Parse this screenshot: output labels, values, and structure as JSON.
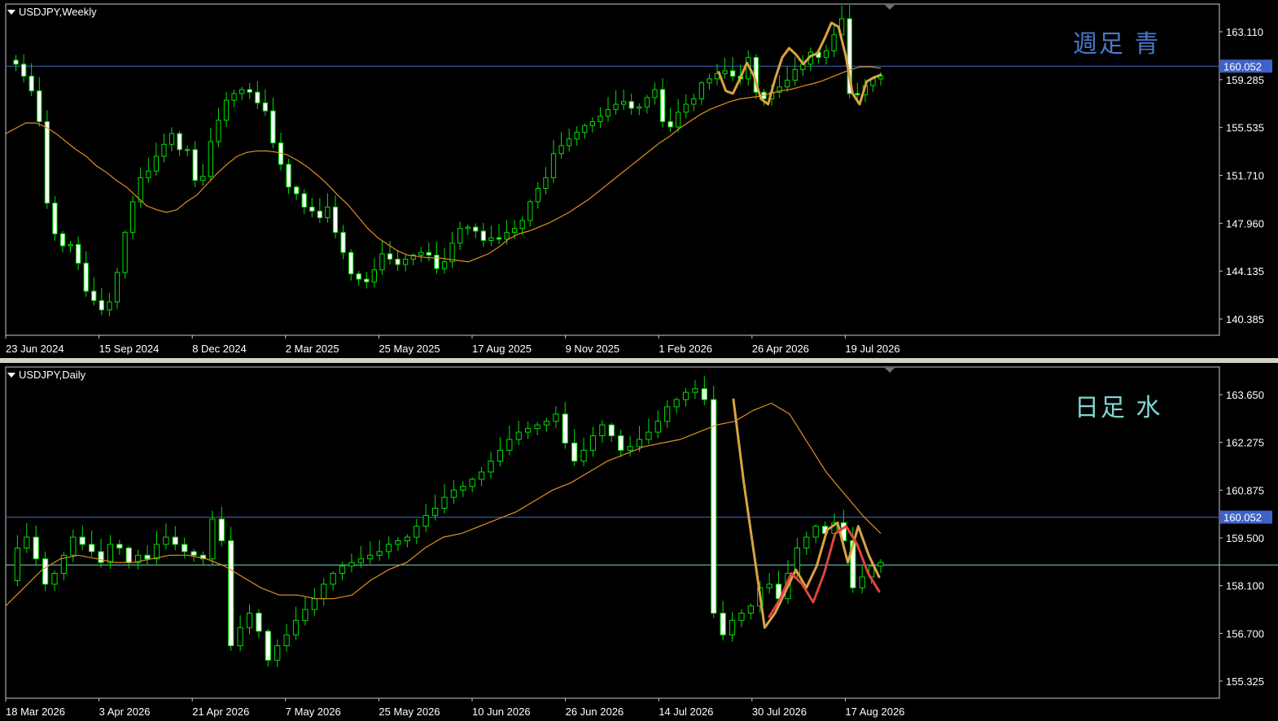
{
  "charts": [
    {
      "title": "USDJPY,Weekly",
      "note": "週足 青",
      "note_color": "#4a78c8",
      "price_line": "160.052",
      "y_ticks": [
        "163.110",
        "159.285",
        "155.535",
        "151.710",
        "147.960",
        "144.135",
        "140.385"
      ],
      "x_ticks": [
        "23 Jun 2024",
        "15 Sep 2024",
        "8 Dec 2024",
        "2 Mar 2025",
        "25 May 2025",
        "17 Aug 2025",
        "9 Nov 2025",
        "1 Feb 2026",
        "26 Apr 2026",
        "19 Jul 2026"
      ]
    },
    {
      "title": "USDJPY,Daily",
      "note": "日足 水",
      "note_color": "#7fd8d0",
      "price_line": "160.052",
      "y_ticks": [
        "163.650",
        "162.275",
        "160.875",
        "159.500",
        "158.100",
        "156.700",
        "155.325"
      ],
      "x_ticks": [
        "18 Mar 2026",
        "3 Apr 2026",
        "21 Apr 2026",
        "7 May 2026",
        "25 May 2026",
        "10 Jun 2026",
        "26 Jun 2026",
        "14 Jul 2026",
        "30 Jul 2026",
        "17 Aug 2026"
      ]
    }
  ],
  "chart_data": [
    {
      "type": "candlestick",
      "symbol": "USDJPY",
      "timeframe": "Weekly",
      "ylim": [
        139.9,
        164.7
      ],
      "horizontal_levels": [
        160.052
      ],
      "close_path": [
        160.5,
        160.2,
        159.3,
        158.2,
        155.9,
        149.8,
        147.5,
        146.6,
        146.7,
        145.3,
        143.2,
        142.5,
        141.8,
        142.4,
        144.6,
        147.6,
        149.9,
        151.7,
        152.2,
        153.3,
        154.2,
        155.0,
        153.8,
        153.8,
        151.5,
        151.8,
        154.4,
        156.0,
        157.5,
        158.0,
        158.3,
        158.1,
        157.3,
        156.7,
        154.3,
        152.7,
        151.0,
        150.5,
        149.5,
        149.2,
        148.7,
        149.5,
        147.6,
        146.1,
        144.5,
        144.1,
        143.9,
        144.8,
        146.0,
        145.6,
        145.2,
        145.6,
        145.9,
        146.1,
        145.9,
        144.9,
        145.4,
        146.8,
        147.9,
        148.0,
        147.7,
        147.0,
        147.2,
        147.1,
        147.6,
        147.9,
        148.5,
        149.9,
        150.9,
        151.7,
        153.5,
        154.1,
        154.6,
        155.1,
        155.6,
        155.9,
        156.3,
        156.8,
        157.2,
        157.4,
        156.9,
        157.0,
        157.7,
        158.3,
        155.9,
        155.5,
        156.6,
        157.2,
        157.6,
        158.8,
        159.1,
        159.5,
        159.7,
        159.3,
        159.1,
        160.7,
        158.1,
        157.6,
        158.1,
        158.5,
        159.0,
        159.8,
        160.2,
        161.1,
        160.7,
        161.2,
        162.4,
        163.6,
        158.0,
        157.9,
        158.6,
        159.1,
        159.3
      ],
      "ma_line": [
        155.0,
        155.4,
        155.8,
        155.8,
        155.5,
        155.0,
        154.4,
        153.8,
        153.3,
        152.6,
        152.1,
        151.5,
        151.0,
        150.3,
        149.6,
        149.3,
        149.1,
        149.3,
        149.9,
        150.4,
        151.2,
        152.0,
        152.7,
        153.3,
        153.6,
        153.7,
        153.7,
        153.6,
        153.4,
        153.0,
        152.5,
        151.9,
        151.2,
        150.4,
        149.7,
        148.8,
        147.9,
        147.2,
        146.7,
        146.2,
        145.9,
        145.8,
        145.7,
        145.7,
        145.6,
        145.5,
        145.4,
        145.7,
        146.0,
        146.5,
        147.1,
        147.5,
        147.7,
        148.0,
        148.3,
        148.7,
        149.1,
        149.6,
        150.1,
        150.7,
        151.3,
        151.9,
        152.5,
        153.1,
        153.7,
        154.3,
        154.8,
        155.4,
        155.9,
        156.4,
        156.8,
        157.1,
        157.4,
        157.6,
        157.7,
        157.8,
        158.0,
        158.2,
        158.3,
        158.5,
        158.7,
        158.9,
        159.2,
        159.5,
        159.8,
        160.0,
        160.0,
        159.9
      ],
      "annotation_path": [
        159.6,
        158.2,
        158.0,
        159.1,
        160.3,
        159.3,
        157.6,
        157.2,
        159.1,
        160.7,
        161.4,
        160.9,
        160.2,
        160.8,
        161.0,
        162.1,
        163.3,
        163.0,
        160.9,
        158.0,
        157.2,
        158.9,
        159.2,
        159.4
      ]
    },
    {
      "type": "candlestick",
      "symbol": "USDJPY",
      "timeframe": "Daily",
      "ylim": [
        155.05,
        164.2
      ],
      "horizontal_levels": [
        160.052,
        158.73
      ],
      "close_path": [
        158.3,
        159.2,
        159.5,
        158.9,
        158.2,
        158.5,
        159.0,
        159.5,
        159.3,
        159.1,
        158.8,
        159.3,
        159.2,
        158.8,
        159.0,
        158.9,
        159.3,
        159.5,
        159.3,
        159.1,
        159.0,
        158.9,
        160.0,
        159.4,
        156.5,
        157.0,
        157.4,
        156.9,
        156.1,
        156.5,
        156.8,
        157.2,
        157.5,
        157.8,
        158.2,
        158.5,
        158.7,
        158.8,
        158.9,
        159.0,
        159.1,
        159.3,
        159.4,
        159.5,
        159.8,
        160.1,
        160.3,
        160.6,
        160.8,
        160.9,
        161.1,
        161.3,
        161.6,
        161.9,
        162.2,
        162.4,
        162.5,
        162.6,
        162.7,
        162.9,
        162.1,
        161.6,
        161.9,
        162.3,
        162.6,
        162.3,
        161.9,
        162.0,
        162.2,
        162.4,
        162.7,
        163.1,
        163.3,
        163.5,
        163.6,
        163.3,
        157.4,
        156.8,
        157.2,
        157.4,
        157.6,
        158.1,
        158.2,
        157.8,
        158.5,
        159.2,
        159.5,
        159.8,
        159.6,
        159.9,
        159.4,
        158.1,
        158.4,
        158.7,
        158.8
      ],
      "ma_line": [
        157.6,
        158.1,
        158.6,
        158.9,
        159.0,
        158.9,
        158.8,
        158.8,
        158.9,
        159.0,
        159.0,
        158.9,
        158.7,
        158.4,
        158.1,
        157.9,
        157.9,
        157.8,
        157.8,
        157.9,
        158.3,
        158.6,
        158.8,
        159.2,
        159.5,
        159.6,
        159.8,
        160.0,
        160.2,
        160.5,
        160.8,
        161.0,
        161.3,
        161.6,
        161.8,
        162.0,
        162.1,
        162.2,
        162.4,
        162.6,
        162.7,
        163.0,
        163.2,
        162.9,
        162.1,
        161.3,
        160.7,
        160.1,
        159.6
      ],
      "annotation_paths": [
        {
          "color": "#d9a441",
          "values": [
            163.3,
            161.0,
            159.0,
            157.0,
            157.4,
            158.0,
            158.6,
            158.1,
            158.7,
            159.7,
            159.9,
            158.8,
            159.8,
            159.0,
            158.4
          ]
        },
        {
          "color": "#e0443f",
          "values": [
            157.3,
            157.8,
            158.5,
            158.2,
            157.7,
            158.5,
            159.6,
            159.8,
            159.3,
            158.5,
            158.0
          ]
        }
      ]
    }
  ]
}
